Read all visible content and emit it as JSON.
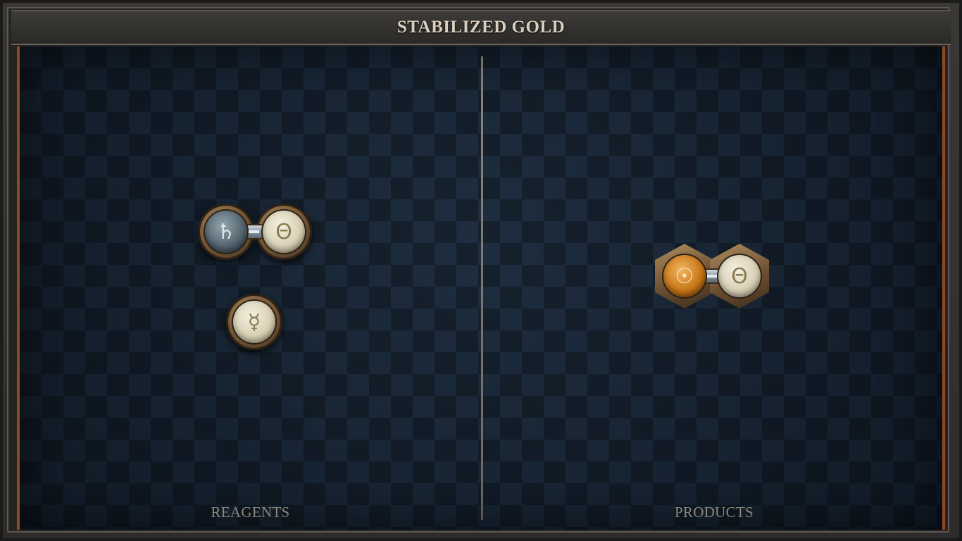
{
  "title": "STABILIZED GOLD",
  "reagents": {
    "label": "REAGENTS",
    "molecules": [
      {
        "atoms": [
          {
            "element": "lead",
            "symbol": "♄"
          },
          {
            "element": "salt",
            "symbol": "Θ"
          }
        ],
        "bonds": 1
      },
      {
        "atoms": [
          {
            "element": "quicksilver",
            "symbol": "☿"
          }
        ],
        "bonds": 0
      }
    ]
  },
  "products": {
    "label": "PRODUCTS",
    "molecules": [
      {
        "atoms": [
          {
            "element": "gold",
            "symbol": "☉"
          },
          {
            "element": "salt",
            "symbol": "Θ"
          }
        ],
        "bonds": 1
      }
    ]
  },
  "colors": {
    "background": "#152232",
    "accent_copper": "#8a4a22",
    "title_text": "#d9cfbe",
    "label_text": "#a59e92"
  }
}
